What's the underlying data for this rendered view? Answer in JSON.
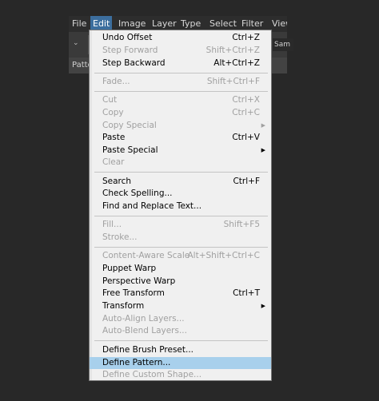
{
  "menubar": {
    "items": [
      {
        "label": "File"
      },
      {
        "label": "Edit"
      },
      {
        "label": "Image"
      },
      {
        "label": "Layer"
      },
      {
        "label": "Type"
      },
      {
        "label": "Select"
      },
      {
        "label": "Filter"
      },
      {
        "label": "View"
      }
    ]
  },
  "options_bar": {
    "field_text": "Sam"
  },
  "panel": {
    "tab_label": "Patte"
  },
  "edit_menu": {
    "items": [
      {
        "label": "Undo Offset",
        "shortcut": "Ctrl+Z",
        "enabled": true
      },
      {
        "label": "Step Forward",
        "shortcut": "Shift+Ctrl+Z",
        "enabled": false
      },
      {
        "label": "Step Backward",
        "shortcut": "Alt+Ctrl+Z",
        "enabled": true
      },
      {
        "label": "Fade...",
        "shortcut": "Shift+Ctrl+F",
        "enabled": false
      },
      {
        "label": "Cut",
        "shortcut": "Ctrl+X",
        "enabled": false
      },
      {
        "label": "Copy",
        "shortcut": "Ctrl+C",
        "enabled": false
      },
      {
        "label": "Copy Special",
        "shortcut": "",
        "enabled": false,
        "submenu": true
      },
      {
        "label": "Paste",
        "shortcut": "Ctrl+V",
        "enabled": true
      },
      {
        "label": "Paste Special",
        "shortcut": "",
        "enabled": true,
        "submenu": true
      },
      {
        "label": "Clear",
        "shortcut": "",
        "enabled": false
      },
      {
        "label": "Search",
        "shortcut": "Ctrl+F",
        "enabled": true
      },
      {
        "label": "Check Spelling...",
        "shortcut": "",
        "enabled": true
      },
      {
        "label": "Find and Replace Text...",
        "shortcut": "",
        "enabled": true
      },
      {
        "label": "Fill...",
        "shortcut": "Shift+F5",
        "enabled": false
      },
      {
        "label": "Stroke...",
        "shortcut": "",
        "enabled": false
      },
      {
        "label": "Content-Aware Scale",
        "shortcut": "Alt+Shift+Ctrl+C",
        "enabled": false
      },
      {
        "label": "Puppet Warp",
        "shortcut": "",
        "enabled": true
      },
      {
        "label": "Perspective Warp",
        "shortcut": "",
        "enabled": true
      },
      {
        "label": "Free Transform",
        "shortcut": "Ctrl+T",
        "enabled": true
      },
      {
        "label": "Transform",
        "shortcut": "",
        "enabled": true,
        "submenu": true
      },
      {
        "label": "Auto-Align Layers...",
        "shortcut": "",
        "enabled": false
      },
      {
        "label": "Auto-Blend Layers...",
        "shortcut": "",
        "enabled": false
      },
      {
        "label": "Define Brush Preset...",
        "shortcut": "",
        "enabled": true
      },
      {
        "label": "Define Pattern...",
        "shortcut": "",
        "enabled": true,
        "highlighted": true
      },
      {
        "label": "Define Custom Shape...",
        "shortcut": "",
        "enabled": false
      }
    ]
  }
}
